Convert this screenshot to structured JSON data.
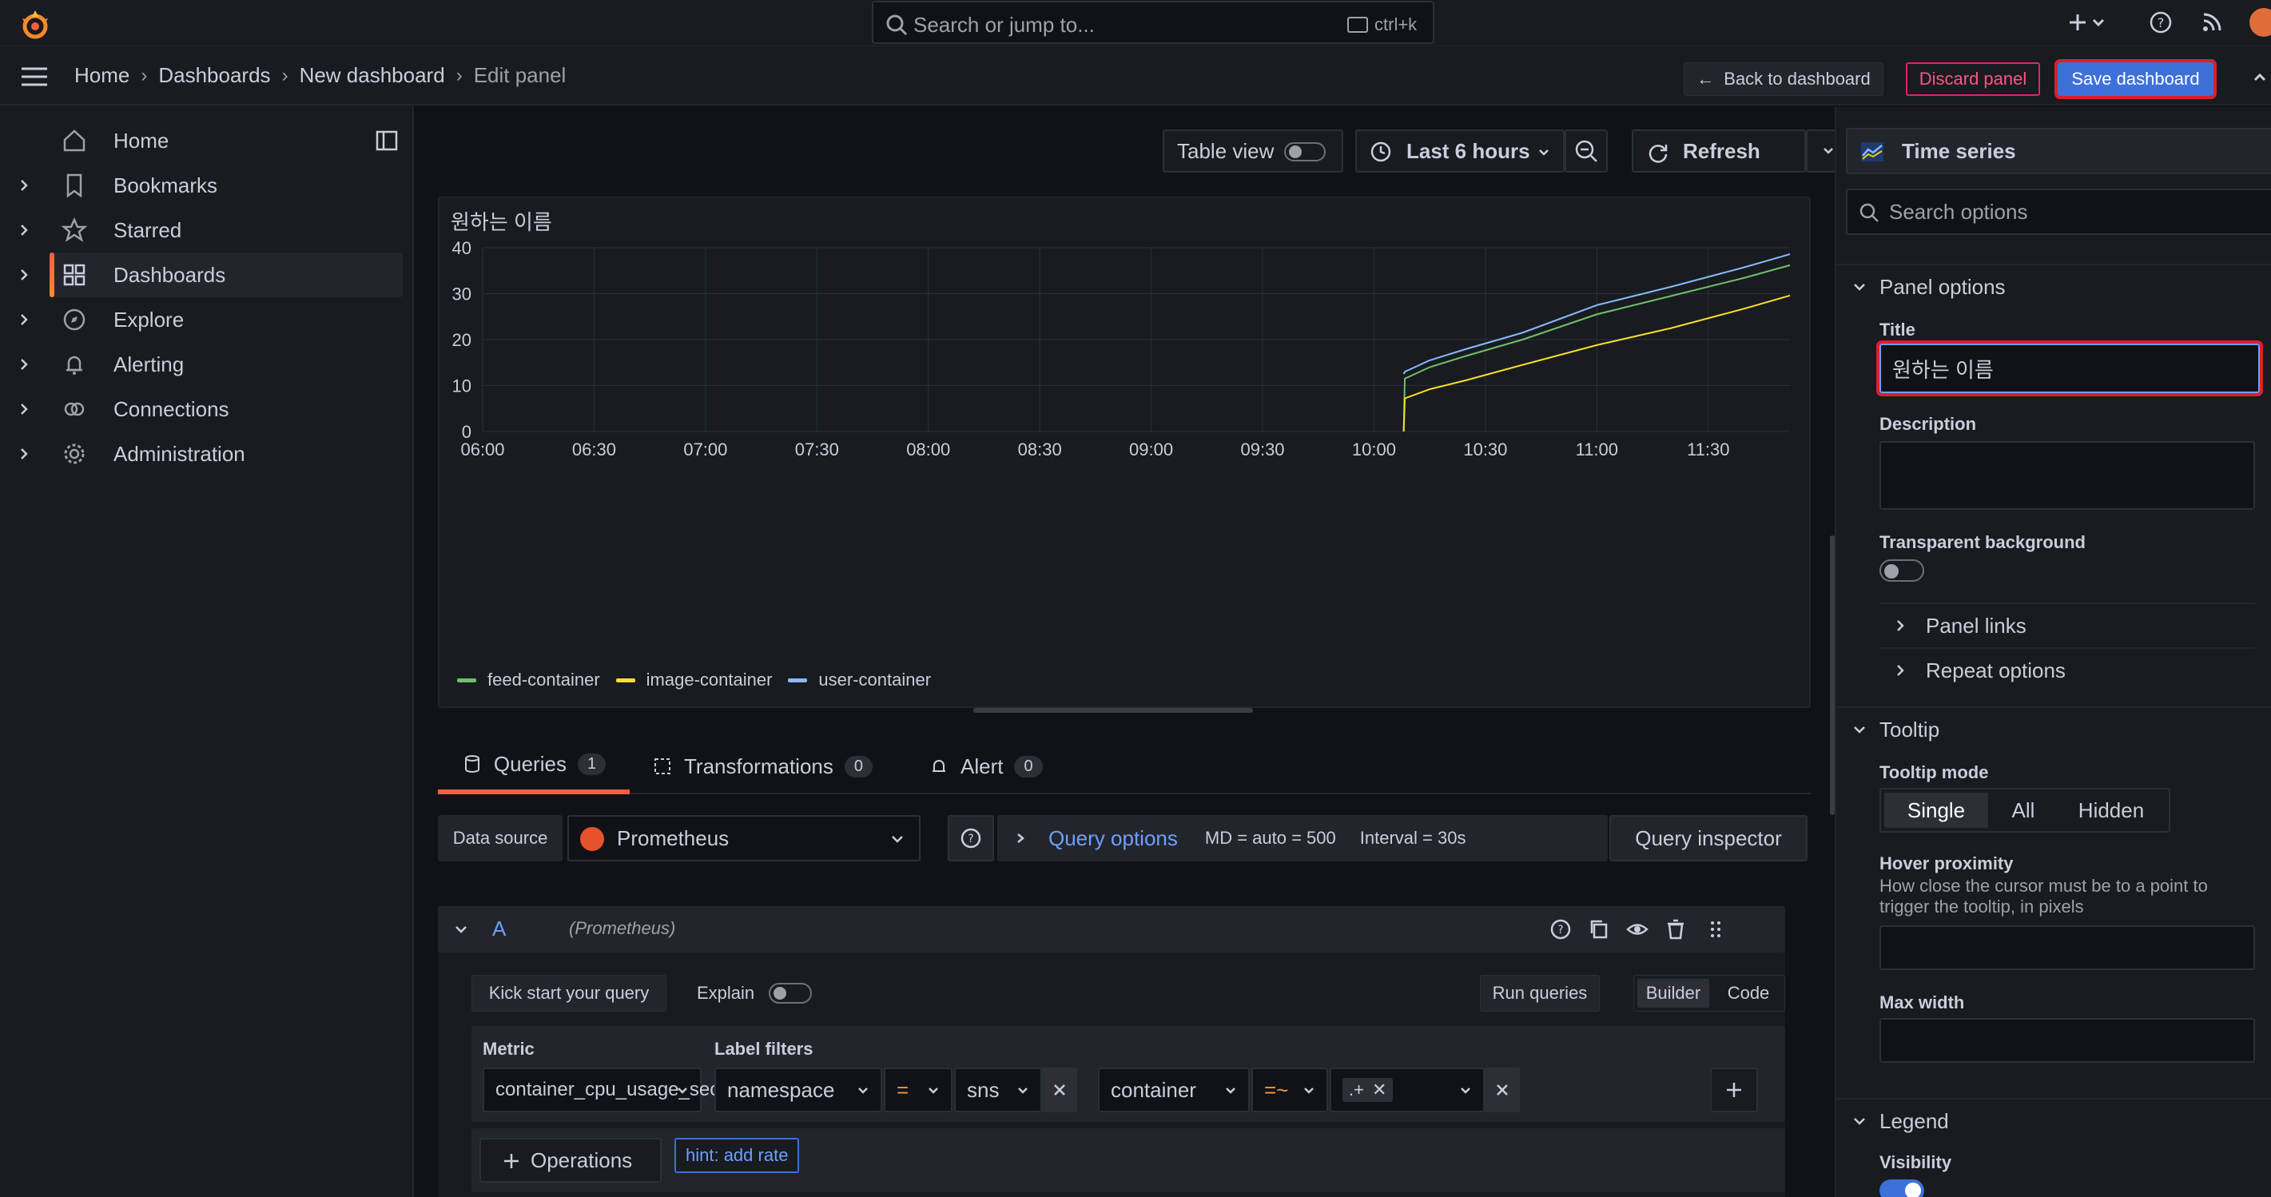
{
  "topbar": {
    "search_placeholder": "Search or jump to...",
    "shortcut": "ctrl+k",
    "icons": [
      "grafana-logo-icon",
      "search-icon",
      "keyboard-icon",
      "plus-icon",
      "chevron-down-icon",
      "help-icon",
      "rss-icon",
      "avatar"
    ]
  },
  "breadcrumb": [
    "Home",
    "Dashboards",
    "New dashboard",
    "Edit panel"
  ],
  "nav_actions": {
    "back": "Back to dashboard",
    "discard": "Discard panel",
    "save": "Save dashboard"
  },
  "sidebar": {
    "items": [
      {
        "label": "Home",
        "icon": "home-icon"
      },
      {
        "label": "Bookmarks",
        "icon": "bookmark-icon"
      },
      {
        "label": "Starred",
        "icon": "star-icon"
      },
      {
        "label": "Dashboards",
        "icon": "apps-icon",
        "active": true
      },
      {
        "label": "Explore",
        "icon": "compass-icon"
      },
      {
        "label": "Alerting",
        "icon": "bell-icon"
      },
      {
        "label": "Connections",
        "icon": "link-icon"
      },
      {
        "label": "Administration",
        "icon": "cog-icon"
      }
    ]
  },
  "toolbar": {
    "table_view": "Table view",
    "time_range": "Last 6 hours",
    "refresh": "Refresh"
  },
  "panel": {
    "title": "원하는 이름"
  },
  "colors": {
    "feed": "#73bf69",
    "image": "#fade2a",
    "user": "#8ab8ff",
    "accent": "#f55f3e",
    "primary": "#3d71d9"
  },
  "chart_data": {
    "type": "line",
    "title": "원하는 이름",
    "x_ticks": [
      "06:00",
      "06:30",
      "07:00",
      "07:30",
      "08:00",
      "08:30",
      "09:00",
      "09:30",
      "10:00",
      "10:30",
      "11:00",
      "11:30"
    ],
    "y_ticks": [
      "0",
      "10",
      "20",
      "30",
      "40"
    ],
    "ylim": [
      0,
      40
    ],
    "x_unit": "minutes since 06:00",
    "xlim": [
      0,
      352
    ],
    "legend_position": "bottom-left",
    "grid": true,
    "series": [
      {
        "name": "feed-container",
        "color": "#73bf69",
        "x": [
          248,
          248.3,
          255,
          265,
          280,
          300,
          320,
          340,
          352
        ],
        "y": [
          0,
          11.5,
          14.0,
          16.5,
          20,
          25.5,
          29.5,
          33.5,
          36.2
        ]
      },
      {
        "name": "image-container",
        "color": "#fade2a",
        "x": [
          248,
          248.3,
          255,
          265,
          280,
          300,
          320,
          340,
          352
        ],
        "y": [
          0,
          7.2,
          9.2,
          11.2,
          14.5,
          18.8,
          22.5,
          26.8,
          29.6
        ]
      },
      {
        "name": "user-container",
        "color": "#8ab8ff",
        "x": [
          248,
          248.3,
          255,
          265,
          280,
          300,
          320,
          340,
          352
        ],
        "y": [
          12.5,
          13.0,
          15.5,
          18.0,
          21.5,
          27.5,
          31.5,
          35.8,
          38.6
        ]
      }
    ]
  },
  "tabs": [
    {
      "label": "Queries",
      "count": "1",
      "icon": "database-icon"
    },
    {
      "label": "Transformations",
      "count": "0",
      "icon": "transform-icon"
    },
    {
      "label": "Alert",
      "count": "0",
      "icon": "bell-icon"
    }
  ],
  "datasource": {
    "label": "Data source",
    "value": "Prometheus",
    "query_options": "Query options",
    "md": "MD = auto = 500",
    "interval": "Interval = 30s",
    "inspector": "Query inspector"
  },
  "query": {
    "letter": "A",
    "ds": "(Prometheus)",
    "kickstart": "Kick start your query",
    "explain": "Explain",
    "run": "Run queries",
    "builder": "Builder",
    "code": "Code",
    "metric_label": "Metric",
    "metric": "container_cpu_usage_seconds_total",
    "label_filters": "Label filters",
    "filter1": {
      "label": "namespace",
      "op": "=",
      "value": "sns"
    },
    "filter2": {
      "label": "container",
      "op": "=~",
      "value": ".+"
    },
    "operations": "Operations",
    "hint": "hint: add rate"
  },
  "options": {
    "viz": "Time series",
    "search_placeholder": "Search options",
    "panel_options": "Panel options",
    "title_label": "Title",
    "title_value": "원하는 이름",
    "description_label": "Description",
    "transparent_label": "Transparent background",
    "panel_links": "Panel links",
    "repeat_options": "Repeat options",
    "tooltip": "Tooltip",
    "tooltip_mode": "Tooltip mode",
    "modes": [
      "Single",
      "All",
      "Hidden"
    ],
    "hover_proximity": "Hover proximity",
    "hover_desc": "How close the cursor must be to a point to trigger the tooltip, in pixels",
    "max_width": "Max width",
    "legend": "Legend",
    "visibility": "Visibility"
  }
}
